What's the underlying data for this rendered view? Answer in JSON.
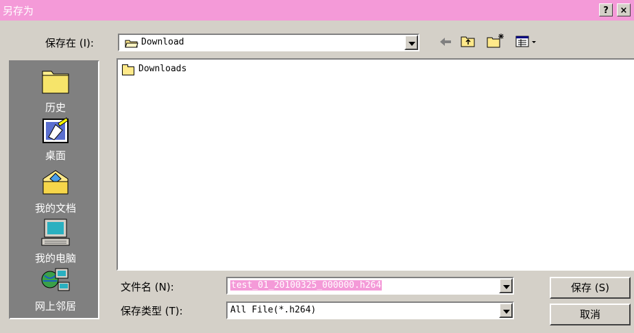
{
  "window": {
    "title": "另存为",
    "help_label": "?",
    "close_label": "×"
  },
  "save_in": {
    "label": "保存在 (I):",
    "value": "Download"
  },
  "toolbar": {
    "back_icon": "back-arrow-icon",
    "up_icon": "up-folder-icon",
    "new_folder_icon": "new-folder-icon",
    "view_icon": "view-menu-icon"
  },
  "places": [
    {
      "label": "历史",
      "icon": "history-icon"
    },
    {
      "label": "桌面",
      "icon": "desktop-icon"
    },
    {
      "label": "我的文档",
      "icon": "my-documents-icon"
    },
    {
      "label": "我的电脑",
      "icon": "my-computer-icon"
    },
    {
      "label": "网上邻居",
      "icon": "network-places-icon"
    }
  ],
  "files": [
    {
      "name": "Downloads",
      "icon": "folder-icon"
    }
  ],
  "filename": {
    "label": "文件名 (N):",
    "value": "test_01_20100325_000000.h264"
  },
  "filetype": {
    "label": "保存类型 (T):",
    "value": "All File(*.h264)"
  },
  "buttons": {
    "save": "保存 (S)",
    "cancel": "取消"
  },
  "colors": {
    "titlebar": "#f49ad8",
    "dialog": "#d4d0c8",
    "places_bar": "#808080",
    "selection": "#f49ad8"
  }
}
